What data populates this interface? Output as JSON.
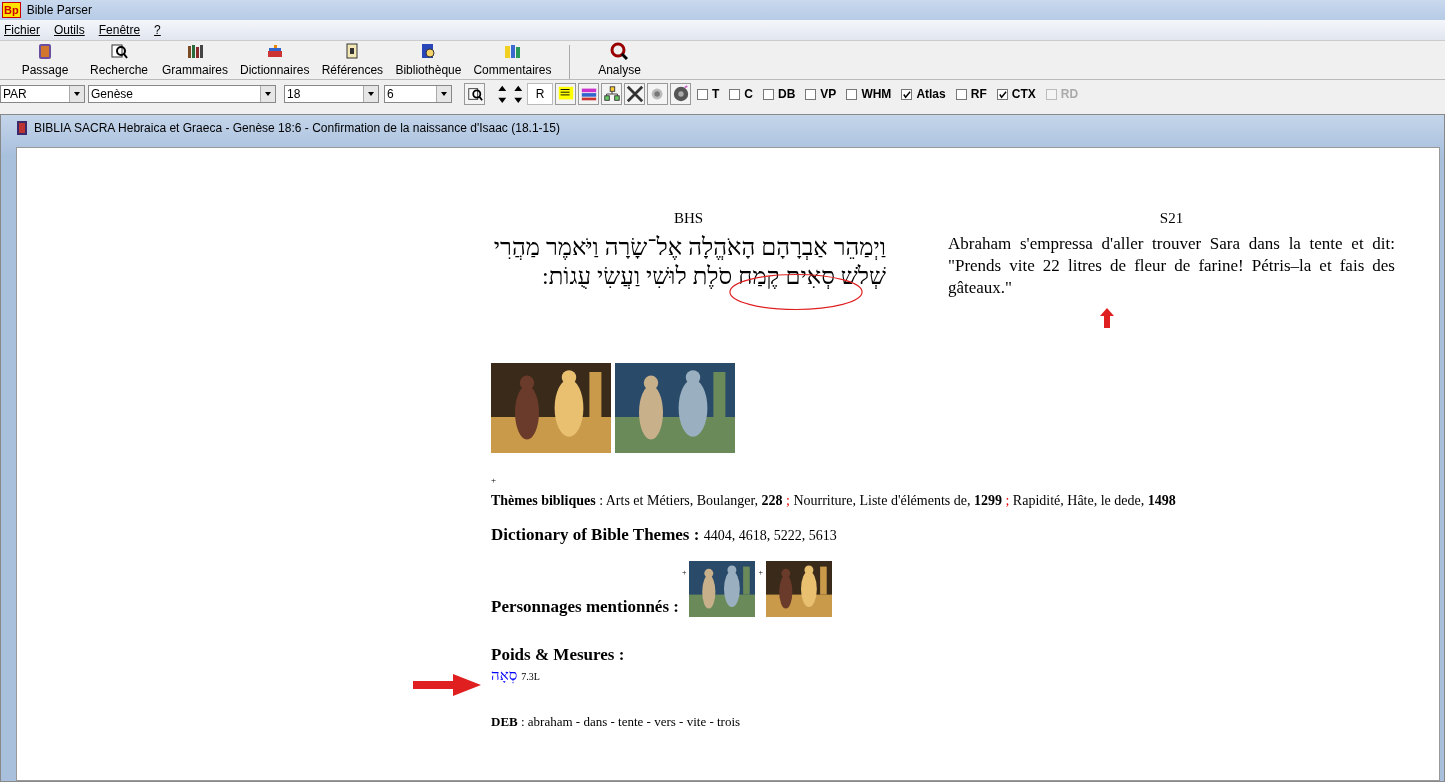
{
  "window": {
    "title": "Bible Parser",
    "logo": "Bp"
  },
  "menu": [
    "Fichier",
    "Outils",
    "Fenêtre",
    "?"
  ],
  "toolbar": [
    {
      "label": "Passage",
      "kind": "book"
    },
    {
      "label": "Recherche",
      "kind": "search"
    },
    {
      "label": "Grammaires",
      "kind": "books"
    },
    {
      "label": "Dictionnaires",
      "kind": "dict"
    },
    {
      "label": "Références",
      "kind": "scroll"
    },
    {
      "label": "Bibliothèque",
      "kind": "library"
    },
    {
      "label": "Commentaires",
      "kind": "comment"
    },
    {
      "label": "Analyse",
      "kind": "analyse"
    }
  ],
  "selectors": [
    {
      "value": "PAR",
      "kind": "short"
    },
    {
      "value": "Genèse",
      "kind": "long"
    },
    {
      "value": "18",
      "kind": "medium"
    },
    {
      "value": "6",
      "kind": "medium"
    }
  ],
  "r_button": "R",
  "options": [
    {
      "label": "T",
      "checked": false,
      "disabled": false
    },
    {
      "label": "C",
      "checked": false,
      "disabled": false
    },
    {
      "label": "DB",
      "checked": false,
      "disabled": false
    },
    {
      "label": "VP",
      "checked": false,
      "disabled": false
    },
    {
      "label": "WHM",
      "checked": false,
      "disabled": false
    },
    {
      "label": "Atlas",
      "checked": true,
      "disabled": false
    },
    {
      "label": "RF",
      "checked": false,
      "disabled": false
    },
    {
      "label": "CTX",
      "checked": true,
      "disabled": false
    },
    {
      "label": "RD",
      "checked": false,
      "disabled": true
    }
  ],
  "document": {
    "title": "BIBLIA SACRA Hebraica et Graeca - Genèse 18:6 - Confirmation de la naissance d'Isaac (18.1-15)",
    "columns": [
      {
        "heading": "BHS",
        "kind": "hebrew",
        "lines": [
          "וַיְמַהֵר אַבְרָהָם הָאֹהֱלָה אֶל־שָׂרָה וַיֹּאמֶר מַהֲרִי",
          "שְׁלֹשׁ סְאִים קֶמַח סֹלֶת לוּשִׁי וַעֲשִׂי עֻגוֹת:"
        ]
      },
      {
        "heading": "S21",
        "kind": "french",
        "lines": [
          "Abraham s'empressa d'aller trouver Sara dans la tente et dit: \"Prends vite 22 litres de fleur de farine! Pétris–la et fais des gâteaux.\""
        ]
      }
    ],
    "plus": "+",
    "themes": {
      "label": "Thèmes bibliques",
      "colon": ":",
      "parts": [
        {
          "kind": "text",
          "text": "Arts et Métiers, Boulanger, **228**"
        },
        {
          "kind": "separator",
          "text": ";"
        },
        {
          "kind": "text",
          "text": "Nourriture, Liste d'éléments de, **1299**"
        },
        {
          "kind": "separator",
          "text": ";"
        },
        {
          "kind": "text",
          "text": "Rapidité, Hâte, le dede, **1498**"
        }
      ]
    },
    "dbt": {
      "label": "Dictionary of Bible Themes :",
      "value": "4404, 4618, 5222, 5613"
    },
    "persons": {
      "label": "Personnages mentionnés :",
      "items": [
        {
          "mark": "+",
          "kind": "picture"
        },
        {
          "mark": "+",
          "kind": "picture"
        }
      ]
    },
    "measures": {
      "label": "Poids & Mesures :",
      "word": "סְאָה",
      "value": "7.3L"
    },
    "deb": {
      "label": "DEB",
      "value": ": abraham - dans - tente - vers - vite - trois"
    }
  }
}
